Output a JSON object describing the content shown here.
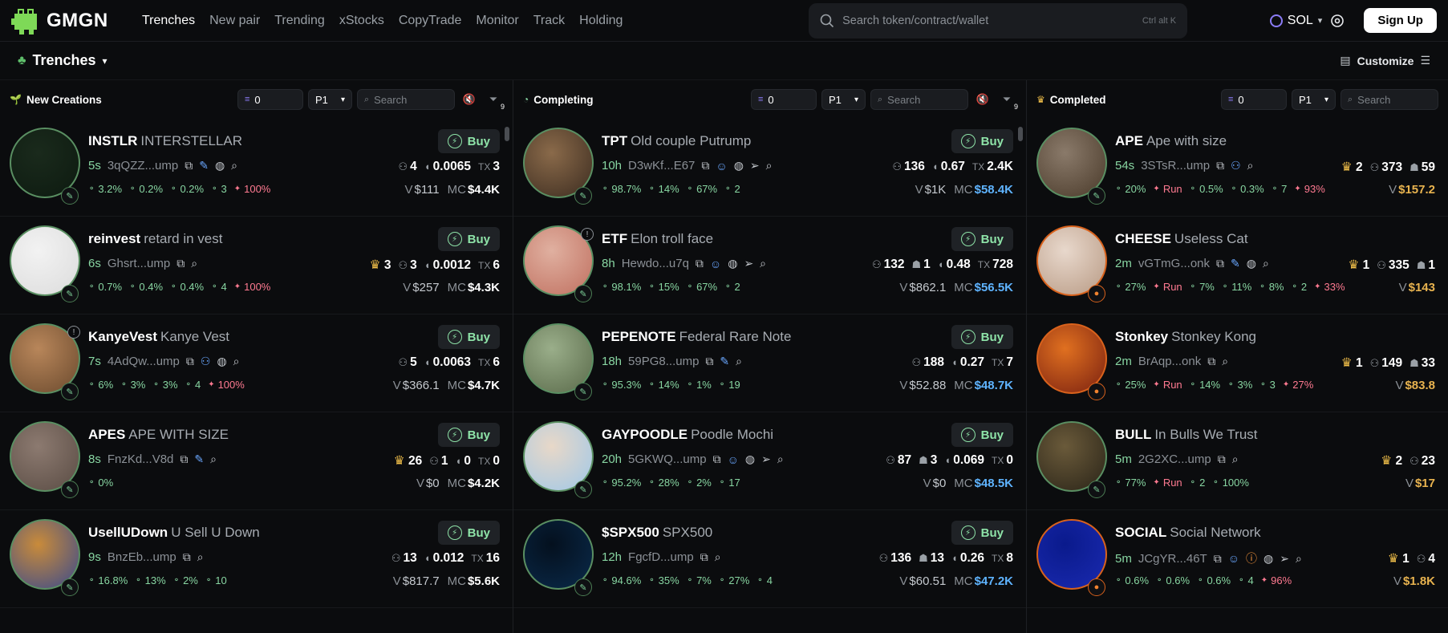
{
  "app": {
    "logo_text": "GMGN"
  },
  "nav": [
    "Trenches",
    "New pair",
    "Trending",
    "xStocks",
    "CopyTrade",
    "Monitor",
    "Track",
    "Holding"
  ],
  "search": {
    "placeholder": "Search token/contract/wallet",
    "shortcut": "Ctrl alt K"
  },
  "chain": "SOL",
  "signup": "Sign Up",
  "page": {
    "title": "Trenches",
    "customize": "Customize"
  },
  "columns": [
    {
      "title": "New Creations",
      "amount": "0",
      "preset": "P1",
      "search_placeholder": "Search",
      "filter_count": "9",
      "rows": [
        {
          "sym": "INSTLR",
          "name": "INTERSTELLAR",
          "age": "5s",
          "addr": "3qQZZ...ump",
          "icons": [
            "pump-icon",
            "globe-icon",
            "search-icon"
          ],
          "stats": [
            "3.2%",
            "0.2%",
            "0.2%",
            "3",
            "100%"
          ],
          "holders": "4",
          "vol_cnt": "0.0065",
          "tx": "3",
          "v": "$111",
          "mc": "$4.4K"
        },
        {
          "sym": "reinvest",
          "name": "retard in vest",
          "age": "6s",
          "addr": "Ghsrt...ump",
          "icons": [
            "search-icon"
          ],
          "stats": [
            "0.7%",
            "0.4%",
            "0.4%",
            "4",
            "100%"
          ],
          "crown": "3",
          "holders": "3",
          "vol_cnt": "0.0012",
          "tx": "6",
          "v": "$257",
          "mc": "$4.3K"
        },
        {
          "sym": "KanyeVest",
          "name": "Kanye Vest",
          "age": "7s",
          "addr": "4AdQw...ump",
          "icons": [
            "group-icon",
            "globe-icon",
            "search-icon"
          ],
          "stats": [
            "6%",
            "3%",
            "3%",
            "4",
            "100%"
          ],
          "holders": "5",
          "vol_cnt": "0.0063",
          "tx": "6",
          "v": "$366.1",
          "mc": "$4.7K"
        },
        {
          "sym": "APES",
          "name": "APE WITH SIZE",
          "age": "8s",
          "addr": "FnzKd...V8d",
          "icons": [
            "pump-icon",
            "search-icon"
          ],
          "stats": [
            "0%"
          ],
          "crown": "26",
          "holders": "1",
          "vol_cnt": "0",
          "tx": "0",
          "v": "$0",
          "mc": "$4.2K"
        },
        {
          "sym": "UsellUDown",
          "name": "U Sell U Down",
          "age": "9s",
          "addr": "BnzEb...ump",
          "icons": [
            "search-icon"
          ],
          "stats": [
            "16.8%",
            "13%",
            "2%",
            "10"
          ],
          "holders": "13",
          "vol_cnt": "0.012",
          "tx": "16",
          "v": "$817.7",
          "mc": "$5.6K"
        }
      ]
    },
    {
      "title": "Completing",
      "amount": "0",
      "preset": "P1",
      "search_placeholder": "Search",
      "filter_count": "9",
      "rows": [
        {
          "sym": "TPT",
          "name": "Old couple Putrump",
          "age": "10h",
          "addr": "D3wKf...E67",
          "icons": [
            "user-icon",
            "globe-icon",
            "telegram-icon",
            "search-icon"
          ],
          "stats": [
            "98.7%",
            "14%",
            "67%",
            "2"
          ],
          "holders": "136",
          "vol_cnt": "0.67",
          "tx": "2.4K",
          "v": "$1K",
          "mc": "$58.4K"
        },
        {
          "sym": "ETF",
          "name": "Elon troll face",
          "age": "8h",
          "addr": "Hewdo...u7q",
          "icons": [
            "user-icon",
            "globe-icon",
            "telegram-icon",
            "search-icon"
          ],
          "stats": [
            "98.1%",
            "15%",
            "67%",
            "2"
          ],
          "holders": "132",
          "bots": "1",
          "vol_cnt": "0.48",
          "tx": "728",
          "v": "$862.1",
          "mc": "$56.5K"
        },
        {
          "sym": "PEPENOTE",
          "name": "Federal Rare Note",
          "age": "18h",
          "addr": "59PG8...ump",
          "icons": [
            "pump-icon",
            "search-icon"
          ],
          "stats": [
            "95.3%",
            "14%",
            "1%",
            "19"
          ],
          "holders": "188",
          "vol_cnt": "0.27",
          "tx": "7",
          "v": "$52.88",
          "mc": "$48.7K"
        },
        {
          "sym": "GAYPOODLE",
          "name": "Poodle Mochi",
          "age": "20h",
          "addr": "5GKWQ...ump",
          "icons": [
            "user-icon",
            "globe-icon",
            "telegram-icon",
            "search-icon"
          ],
          "stats": [
            "95.2%",
            "28%",
            "2%",
            "17"
          ],
          "holders": "87",
          "bots": "3",
          "vol_cnt": "0.069",
          "tx": "0",
          "v": "$0",
          "mc": "$48.5K"
        },
        {
          "sym": "$SPX500",
          "name": "SPX500",
          "age": "12h",
          "addr": "FgcfD...ump",
          "icons": [
            "search-icon"
          ],
          "stats": [
            "94.6%",
            "35%",
            "7%",
            "27%",
            "4"
          ],
          "holders": "136",
          "bots": "13",
          "vol_cnt": "0.26",
          "tx": "8",
          "v": "$60.51",
          "mc": "$47.2K"
        }
      ]
    },
    {
      "title": "Completed",
      "amount": "0",
      "preset": "P1",
      "search_placeholder": "Search",
      "rows": [
        {
          "sym": "APE",
          "name": "Ape with size",
          "age": "54s",
          "addr": "3STsR...ump",
          "icons": [
            "group-icon",
            "search-icon"
          ],
          "stats": [
            "20%",
            "Run",
            "0.5%",
            "0.3%",
            "7",
            "93%"
          ],
          "crown": "2",
          "holders": "373",
          "bots": "59",
          "mc": "$157.2"
        },
        {
          "sym": "CHEESE",
          "name": "Useless Cat",
          "age": "2m",
          "addr": "vGTmG...onk",
          "icons": [
            "pump-icon",
            "globe-icon",
            "search-icon"
          ],
          "stats": [
            "27%",
            "Run",
            "7%",
            "11%",
            "8%",
            "2",
            "33%"
          ],
          "crown": "1",
          "holders": "335",
          "bots": "1",
          "mc": "$143"
        },
        {
          "sym": "Stonkey",
          "name": "Stonkey Kong",
          "age": "2m",
          "addr": "BrAqp...onk",
          "icons": [
            "search-icon"
          ],
          "stats": [
            "25%",
            "Run",
            "14%",
            "3%",
            "3",
            "27%"
          ],
          "crown": "1",
          "holders": "149",
          "bots": "33",
          "mc": "$83.8"
        },
        {
          "sym": "BULL",
          "name": "In Bulls We Trust",
          "age": "5m",
          "addr": "2G2XC...ump",
          "icons": [
            "search-icon"
          ],
          "stats": [
            "77%",
            "Run",
            "2",
            "100%"
          ],
          "crown": "2",
          "holders": "23",
          "mc": "$17"
        },
        {
          "sym": "SOCIAL",
          "name": "Social Network",
          "age": "5m",
          "addr": "JCgYR...46T",
          "icons": [
            "user-icon",
            "alert-icon",
            "globe-icon",
            "telegram-icon",
            "search-icon"
          ],
          "stats": [
            "0.6%",
            "0.6%",
            "0.6%",
            "4",
            "96%"
          ],
          "crown": "1",
          "holders": "4",
          "mc": "$1.8K"
        }
      ]
    }
  ]
}
